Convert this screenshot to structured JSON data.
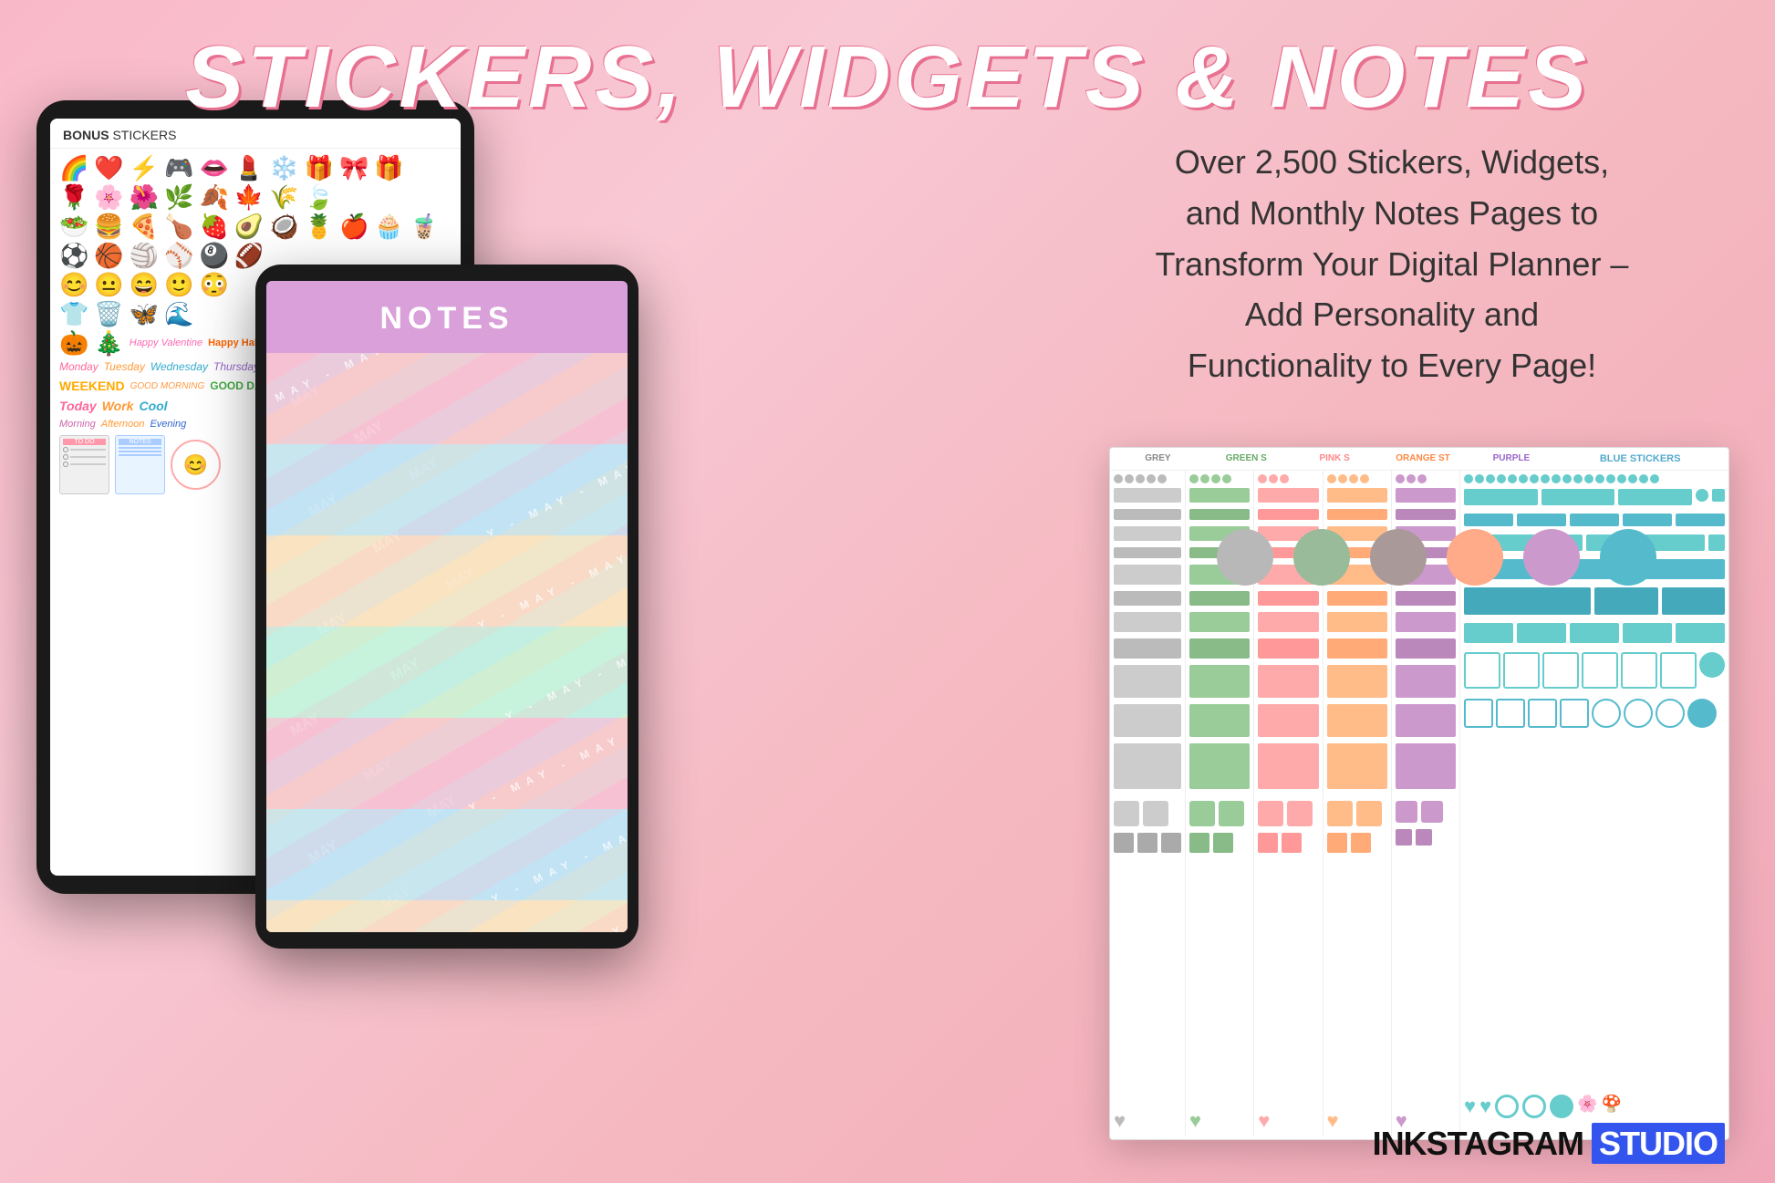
{
  "page": {
    "title": "STICKERS, WIDGETS & NOTES",
    "background_gradient_start": "#f9b8c8",
    "background_gradient_end": "#f0a8b8"
  },
  "right_text": {
    "line1": "Over 2,500 Stickers, Widgets,",
    "line2": "and Monthly Notes Pages to",
    "line3": "Transform Your Digital Planner –",
    "line4": "Add Personality and",
    "line5": "Functionality to Every Page!"
  },
  "color_dots": [
    {
      "color": "#b8b8b8",
      "label": "grey"
    },
    {
      "color": "#99bb99",
      "label": "green"
    },
    {
      "color": "#aa9999",
      "label": "mauve"
    },
    {
      "color": "#ffaa88",
      "label": "orange"
    },
    {
      "color": "#cc99cc",
      "label": "purple"
    },
    {
      "color": "#55bbcc",
      "label": "teal"
    }
  ],
  "tablet_left": {
    "header": "BONUS",
    "header2": " STICKERS"
  },
  "tablet_middle": {
    "notes_label": "NOTES",
    "month": "MAY"
  },
  "sheet_columns": [
    "GREY",
    "GREEN S",
    "PINK S",
    "ORANGE ST",
    "PURPLE",
    "BLUE STICKERS"
  ],
  "brand": {
    "part1": "INKSTAGRAM",
    "part2": "STUDIO"
  }
}
